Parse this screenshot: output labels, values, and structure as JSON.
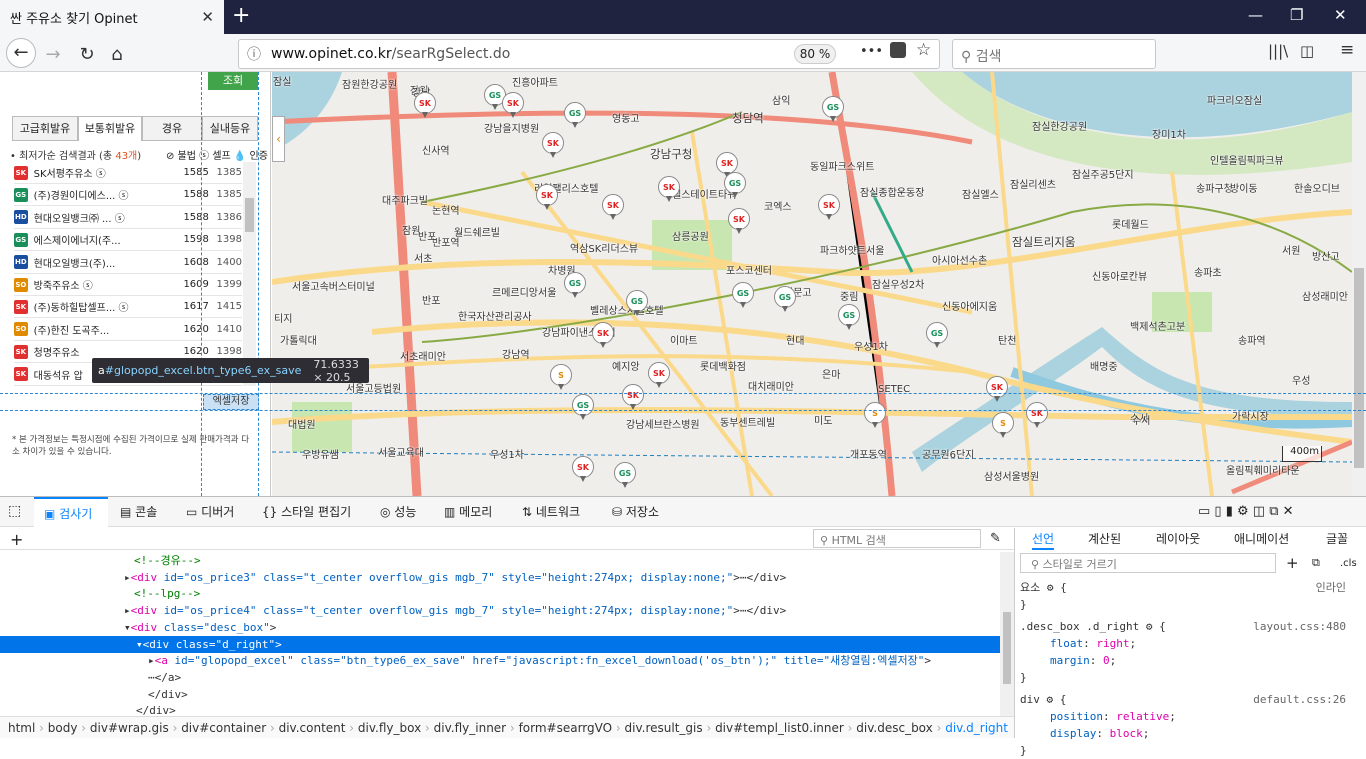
{
  "browser": {
    "tab_title": "싼 주유소 찾기 Opinet",
    "tab_close": "✕",
    "new_tab": "+",
    "url_host": "www.opinet.co.kr",
    "url_path": "/searRgSelect.do",
    "zoom": "80 %",
    "search_placeholder": "검색",
    "menu_dots": "•••"
  },
  "left_panel": {
    "lookup_button": "조회",
    "fuel_tabs": [
      "고급휘발유",
      "보통휘발유",
      "경유",
      "실내등유"
    ],
    "active_tab": "보통휘발유",
    "result_prefix": "• 최저가순 검색결과 (총 ",
    "result_count": "43개",
    "result_suffix": ")",
    "legend": "⊘ 불법  ⓢ 셀프  💧 인증",
    "stations": [
      {
        "name": "SK서평주유소 ⓢ",
        "price": "1585",
        "price2": "1385",
        "brand": "SK"
      },
      {
        "name": "(주)경원이디에스... ⓢ",
        "price": "1588",
        "price2": "1385",
        "brand": "GS"
      },
      {
        "name": "현대오일뱅크㈜ ... ⓢ",
        "price": "1588",
        "price2": "1386",
        "brand": "HD"
      },
      {
        "name": "에스제이에너지(주...",
        "price": "1598",
        "price2": "1398",
        "brand": "GS"
      },
      {
        "name": "현대오일뱅크(주)...",
        "price": "1608",
        "price2": "1400",
        "brand": "HD"
      },
      {
        "name": "방죽주유소 ⓢ",
        "price": "1609",
        "price2": "1399",
        "brand": "SO"
      },
      {
        "name": "(주)동하힐탑셀프... ⓢ",
        "price": "1617",
        "price2": "1415",
        "brand": "SK"
      },
      {
        "name": "(주)한진 도곡주...",
        "price": "1620",
        "price2": "1410",
        "brand": "SO"
      },
      {
        "name": "청명주유소",
        "price": "1620",
        "price2": "1398",
        "brand": "SK"
      },
      {
        "name": "대동석유 압",
        "price": "",
        "price2": "",
        "brand": "SK"
      }
    ],
    "excel_button": "엑셀저장",
    "note": "* 본 가격정보는 특정시점에 수집된 가격이므로 실제 판매가격과 다소 차이가 있을 수 있습니다."
  },
  "inspector_tooltip": {
    "tag": "a",
    "selector": "#glopopd_excel.btn_type6_ex_save",
    "dimensions": "71.6333 × 20.5"
  },
  "map": {
    "labels": [
      {
        "t": "잠원한강공원"
      },
      {
        "t": "잠원"
      },
      {
        "t": "진흥아파트"
      },
      {
        "t": "강남을지병원"
      },
      {
        "t": "신사역"
      },
      {
        "t": "영동고"
      },
      {
        "t": "청담역"
      },
      {
        "t": "삼익"
      },
      {
        "t": "강남구청"
      },
      {
        "t": "동일파크스위트"
      },
      {
        "t": "잠실한강공원"
      },
      {
        "t": "장미1차"
      },
      {
        "t": "파크리오잠실"
      },
      {
        "t": "인텔올림픽파크뷰"
      },
      {
        "t": "리얼팰리스호텔"
      },
      {
        "t": "대주파크빌"
      },
      {
        "t": "논현역"
      },
      {
        "t": "엘스테이트타워"
      },
      {
        "t": "코엑스"
      },
      {
        "t": "잠실종합운동장"
      },
      {
        "t": "잠실엘스"
      },
      {
        "t": "잠실리센츠"
      },
      {
        "t": "잠실주공5단지"
      },
      {
        "t": "송파구청"
      },
      {
        "t": "방이동"
      },
      {
        "t": "한솔오디브"
      },
      {
        "t": "잠원"
      },
      {
        "t": "월드쉐르빌"
      },
      {
        "t": "삼릉공원"
      },
      {
        "t": "반포역"
      },
      {
        "t": "역삼SK리더스뷰"
      },
      {
        "t": "파크하얏트서울"
      },
      {
        "t": "롯데월드"
      },
      {
        "t": "잠실트리지움"
      },
      {
        "t": "서울고속버스터미널"
      },
      {
        "t": "차병원"
      },
      {
        "t": "포스코센터"
      },
      {
        "t": "아시아선수촌"
      },
      {
        "t": "서초"
      },
      {
        "t": "반포"
      },
      {
        "t": "르메르디앙서울"
      },
      {
        "t": "휘문고"
      },
      {
        "t": "신동아로칸뷰"
      },
      {
        "t": "잠실우성2차"
      },
      {
        "t": "송파초"
      },
      {
        "t": "서원"
      },
      {
        "t": "방산고"
      },
      {
        "t": "삼성래미안"
      },
      {
        "t": "한국자산관리공사"
      },
      {
        "t": "벨레상스서울호텔"
      },
      {
        "t": "중림"
      },
      {
        "t": "신동아에지움"
      },
      {
        "t": "백제석촌고분"
      },
      {
        "t": "가톨릭대"
      },
      {
        "t": "강남파이낸스센터"
      },
      {
        "t": "이마트"
      },
      {
        "t": "현대"
      },
      {
        "t": "탄천"
      },
      {
        "t": "우성1차"
      },
      {
        "t": "송파역"
      },
      {
        "t": "서초래미안"
      },
      {
        "t": "강남역"
      },
      {
        "t": "예지앙"
      },
      {
        "t": "롯데백화점"
      },
      {
        "t": "은마"
      },
      {
        "t": "배명중"
      },
      {
        "t": "우성"
      },
      {
        "t": "서울고등법원"
      },
      {
        "t": "대치래미안"
      },
      {
        "t": "SETEC"
      },
      {
        "t": "티지"
      },
      {
        "t": "대법원"
      },
      {
        "t": "강남세브란스병원"
      },
      {
        "t": "동부센트레빌"
      },
      {
        "t": "미도"
      },
      {
        "t": "수서"
      },
      {
        "t": "가락시장"
      },
      {
        "t": "우방유쌤"
      },
      {
        "t": "서울교육대"
      },
      {
        "t": "우성1차"
      },
      {
        "t": "개포동역"
      },
      {
        "t": "공무원6단지"
      },
      {
        "t": "삼성서울병원"
      },
      {
        "t": "올림픽훼미리타운"
      },
      {
        "t": "강남"
      },
      {
        "t": "잠실"
      },
      {
        "t": "반포"
      },
      {
        "t": "수서"
      }
    ],
    "scale_text": "400m",
    "colors": {
      "road_major": "#f08a7a",
      "road_minor": "#fbd98a",
      "water": "#aad3df",
      "park": "#c8e6b0",
      "land": "#f0eeea"
    }
  },
  "devtools": {
    "tabs": [
      "검사기",
      "콘솔",
      "디버거",
      "스타일 편집기",
      "성능",
      "메모리",
      "네트워크",
      "저장소"
    ],
    "active_tab": "검사기",
    "html_search_placeholder": "HTML 검색",
    "markup": [
      {
        "kind": "comment",
        "text": "<!--경유-->"
      },
      {
        "kind": "node",
        "tag": "div",
        "attrs": "id=\"os_price3\" class=\"t_center overflow_gis mgb_7\" style=\"height:274px; display:none;\"",
        "tail": "⋯</div>"
      },
      {
        "kind": "comment",
        "text": "<!--lpg-->"
      },
      {
        "kind": "node",
        "tag": "div",
        "attrs": "id=\"os_price4\" class=\"t_center overflow_gis mgb_7\" style=\"height:274px; display:none;\"",
        "tail": "⋯</div>"
      },
      {
        "kind": "node",
        "tag": "div",
        "attrs": "class=\"desc_box\"",
        "tail": ""
      },
      {
        "kind": "node",
        "tag": "div",
        "attrs": "class=\"d_right\"",
        "tail": ""
      },
      {
        "kind": "node",
        "tag": "a",
        "attrs": "id=\"glopopd_excel\" class=\"btn_type6_ex_save\" href=\"javascript:fn_excel_download('os_btn');\" title=\"새창열림:엑셀저장\"",
        "tail": ""
      },
      {
        "kind": "text",
        "text": "⋯</a>"
      },
      {
        "kind": "text",
        "text": "</div>"
      },
      {
        "kind": "text",
        "text": "</div>"
      }
    ],
    "breadcrumbs": [
      "html",
      "body",
      "div#wrap.gis",
      "div#container",
      "div.content",
      "div.fly_box",
      "div.fly_inner",
      "form#searrgVO",
      "div.result_gis",
      "div#templ_list0.inner",
      "div.desc_box",
      "div.d_right"
    ],
    "rule_tabs": [
      "선언",
      "계산된",
      "레이아웃",
      "애니메이션",
      "글꼴"
    ],
    "rule_filter": "스타일로 거르기",
    "rules": [
      {
        "sel": "요소 ⚙ {",
        "src": "인라인",
        "props": []
      },
      {
        "sel": ".desc_box .d_right ⚙ {",
        "src": "layout.css:480",
        "props": [
          [
            "float",
            "right"
          ],
          [
            "margin",
            "0"
          ]
        ]
      },
      {
        "sel": "div ⚙ {",
        "src": "default.css:26",
        "props": [
          [
            "position",
            "relative"
          ],
          [
            "display",
            "block"
          ]
        ]
      }
    ],
    "cls": ".cls"
  }
}
